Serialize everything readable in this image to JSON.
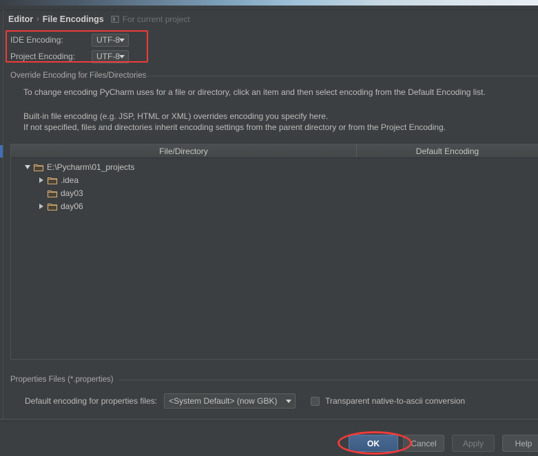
{
  "header": {
    "crumb_parent": "Editor",
    "crumb_sep": "›",
    "crumb_current": "File Encodings",
    "scope_icon": "project-scope-icon",
    "scope_text": "For current project"
  },
  "encoding": {
    "ide_label": "IDE Encoding:",
    "ide_value": "UTF-8",
    "project_label": "Project Encoding:",
    "project_value": "UTF-8"
  },
  "override_group": {
    "title": "Override Encoding for Files/Directories",
    "line1": "To change encoding PyCharm uses for a file or directory, click an item and then select encoding from the Default Encoding list.",
    "line2": "Built-in file encoding (e.g. JSP, HTML or XML) overrides encoding you specify here.",
    "line3": "If not specified, files and directories inherit encoding settings from the parent directory or from the Project Encoding."
  },
  "table": {
    "columns": [
      "File/Directory",
      "Default Encoding"
    ],
    "rows": [
      {
        "label": "E:\\Pycharm\\01_projects",
        "indent": 0,
        "twisty": "down",
        "icon": "folder-icon",
        "encoding": ""
      },
      {
        "label": ".idea",
        "indent": 1,
        "twisty": "right",
        "icon": "folder-icon",
        "encoding": ""
      },
      {
        "label": "day03",
        "indent": 1,
        "twisty": "none",
        "icon": "folder-icon",
        "encoding": ""
      },
      {
        "label": "day06",
        "indent": 1,
        "twisty": "right",
        "icon": "folder-icon",
        "encoding": ""
      }
    ]
  },
  "properties_group": {
    "title": "Properties Files (*.properties)",
    "default_encoding_label": "Default encoding for properties files:",
    "default_encoding_value": "<System Default> (now GBK)",
    "transparent_label": "Transparent native-to-ascii conversion",
    "transparent_checked": false
  },
  "buttons": {
    "ok": "OK",
    "cancel": "Cancel",
    "apply": "Apply",
    "help": "Help"
  },
  "annotations": {
    "color": "#ef3b3b",
    "rect_target": "encoding-fields",
    "ellipse_target": "ok-button"
  },
  "colors": {
    "background": "#3c3f41",
    "text": "#bbbbbb",
    "accent_blue": "#3f6fb5",
    "folder": "#d8b075"
  }
}
